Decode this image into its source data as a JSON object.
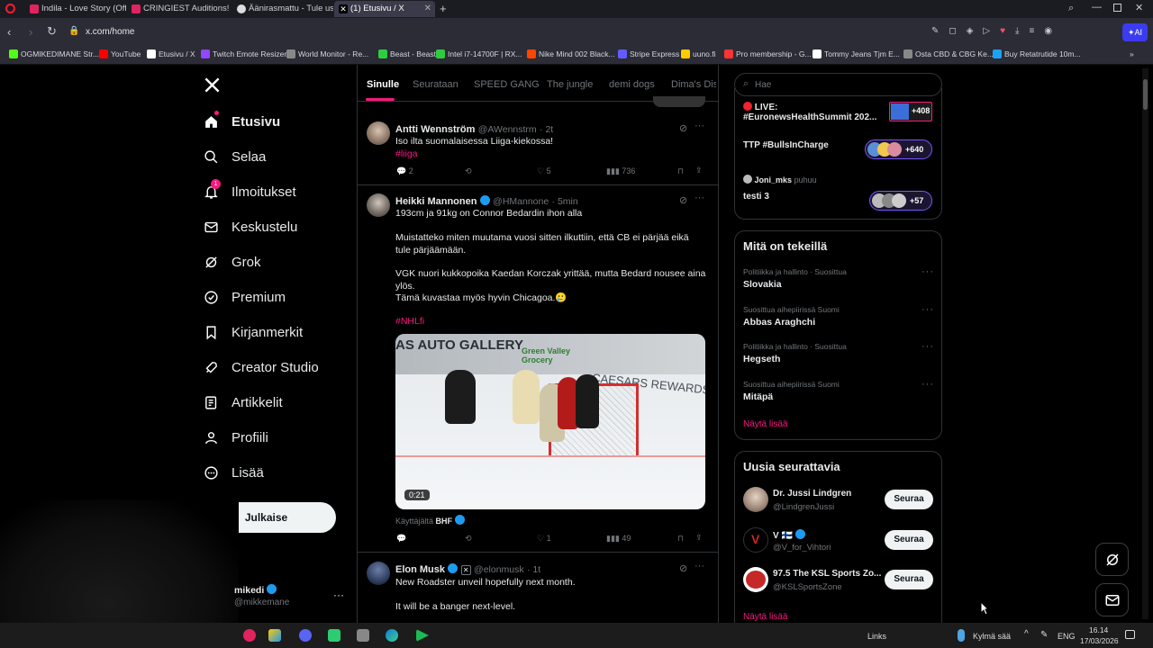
{
  "browser": {
    "tabs": [
      {
        "label": "Indila - Love Story (Officia",
        "color": "#e0245e"
      },
      {
        "label": "CRINGIEST Auditions! Try",
        "color": "#e0245e"
      },
      {
        "label": "Äänirasmattu - Tule uskoo",
        "color": "#dddddd"
      },
      {
        "label": "(1) Etusivu / X",
        "color": "#000000",
        "active": true
      }
    ],
    "url": "x.com/home",
    "bookmarks": [
      {
        "label": "OGMIKEDIMANE Str...",
        "color": "#53fc18"
      },
      {
        "label": "YouTube",
        "color": "#ff0000"
      },
      {
        "label": "Etusivu / X",
        "color": "#ffffff"
      },
      {
        "label": "Twitch Emote Resizer",
        "color": "#9146ff"
      },
      {
        "label": "World Monitor - Re...",
        "color": "#888888"
      },
      {
        "label": "Beast - Beast",
        "color": "#2ecc40"
      },
      {
        "label": "Intel i7-14700F | RX...",
        "color": "#2ecc40"
      },
      {
        "label": "Nike Mind 002 Black...",
        "color": "#ff4500"
      },
      {
        "label": "Stripe Express",
        "color": "#635bff"
      },
      {
        "label": "uuno.fi",
        "color": "#ffcc00"
      },
      {
        "label": "Pro membership - G...",
        "color": "#ff3333"
      },
      {
        "label": "Tommy Jeans Tjm E...",
        "color": "#ffffff"
      },
      {
        "label": "Osta CBD & CBG Ke...",
        "color": "#888888"
      },
      {
        "label": "Buy Retatrutide 10m...",
        "color": "#1da1f2"
      }
    ]
  },
  "nav": {
    "items": [
      {
        "label": "Etusivu",
        "icon": "home-icon"
      },
      {
        "label": "Selaa",
        "icon": "search-icon"
      },
      {
        "label": "Ilmoitukset",
        "icon": "bell-icon",
        "badge": "1"
      },
      {
        "label": "Keskustelu",
        "icon": "mail-icon"
      },
      {
        "label": "Grok",
        "icon": "grok-icon"
      },
      {
        "label": "Premium",
        "icon": "premium-icon"
      },
      {
        "label": "Kirjanmerkit",
        "icon": "bookmark-icon"
      },
      {
        "label": "Creator Studio",
        "icon": "rocket-icon"
      },
      {
        "label": "Artikkelit",
        "icon": "article-icon"
      },
      {
        "label": "Profiili",
        "icon": "person-icon"
      },
      {
        "label": "Lisää",
        "icon": "more-circle-icon"
      }
    ],
    "post_button": "Julkaise",
    "account": {
      "name": "mikedi",
      "handle": "@mikkemane"
    }
  },
  "feed": {
    "tabs": [
      "Sinulle",
      "Seurataan",
      "SPEED GANG",
      "The jungle",
      "demi dogs",
      "Dima's Dist"
    ],
    "tweets": [
      {
        "name": "Antti Wennström",
        "handle": "@AWennstrm",
        "time": "· 2t",
        "text": "Iso ilta suomalaisessa Liiga-kiekossa!",
        "tag": "#liiga",
        "stats": {
          "replies": "2",
          "reposts": "",
          "likes": "5",
          "views": "736"
        }
      },
      {
        "name": "Heikki Mannonen",
        "handle": "@HMannone",
        "time": "· 5min",
        "lines": [
          "193cm ja 91kg on Connor Bedardin ihon alla",
          "Muistatteko miten muutama vuosi sitten ilkuttiin, että CB ei pärjää eikä tule pärjäämään.",
          "VGK nuori kukkopoika Kaedan Korczak yrittää, mutta Bedard nousee aina ylös.",
          "Tämä kuvastaa myös hyvin Chicagoa.🥲"
        ],
        "tag": "#NHLfi",
        "video": {
          "duration": "0:21",
          "ad_text": "CAESARS REWARDS",
          "board_text": "AS AUTO GALLERY",
          "board_text2": "Green Valley Grocery"
        },
        "from_label": "Käyttäjältä",
        "from_user": "BHF",
        "stats": {
          "replies": "",
          "reposts": "",
          "likes": "1",
          "views": "49"
        }
      },
      {
        "name": "Elon Musk",
        "handle": "@elonmusk",
        "time": "· 1t",
        "lines": [
          "New Roadster unveil hopefully next month.",
          "It will be a banger next-level."
        ]
      }
    ]
  },
  "right": {
    "search_placeholder": "Hae",
    "spaces": [
      {
        "label": "LIVE:",
        "title": "#EuronewsHealthSummit 202...",
        "count": "+408"
      },
      {
        "title": "TTP #BullsInCharge",
        "count": "+640"
      },
      {
        "host": "Joni_mks",
        "host_suffix": "puhuu",
        "title": "testi 3",
        "count": "+57"
      }
    ],
    "trends_title": "Mitä on tekeillä",
    "trends": [
      {
        "category": "Politiikka ja hallinto · Suosittua",
        "name": "Slovakia"
      },
      {
        "category": "Suosittua aihepiirissä Suomi",
        "name": "Abbas Araghchi"
      },
      {
        "category": "Politiikka ja hallinto · Suosittua",
        "name": "Hegseth"
      },
      {
        "category": "Suosittua aihepiirissä Suomi",
        "name": "Mitäpä"
      }
    ],
    "show_more": "Näytä lisää",
    "follow_title": "Uusia seurattavia",
    "follow": [
      {
        "name": "Dr. Jussi Lindgren",
        "handle": "@LindgrenJussi",
        "button": "Seuraa"
      },
      {
        "name": "V 🇫🇮",
        "handle": "@V_for_Vihtori",
        "button": "Seuraa"
      },
      {
        "name": "97.5 The KSL Sports Zo...",
        "handle": "@KSLSportsZone",
        "button": "Seuraa"
      }
    ],
    "show_more2": "Näytä lisää"
  },
  "taskbar": {
    "links_label": "Links",
    "weather": "Kylmä sää",
    "lang": "ENG",
    "time": "16.14",
    "date": "17/03/2026"
  }
}
